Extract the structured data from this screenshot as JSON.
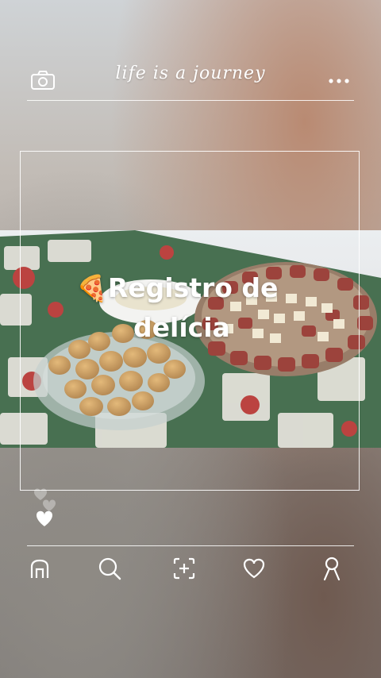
{
  "header": {
    "title": "life is a journey",
    "camera_icon": "camera-icon",
    "more_icon": "more-icon"
  },
  "post": {
    "caption_line1": "Registro de",
    "caption_line2": "delícia",
    "emoji": "🍕"
  },
  "nav": {
    "items": [
      "home-icon",
      "search-icon",
      "add-post-icon",
      "heart-icon",
      "profile-icon"
    ]
  },
  "colors": {
    "line": "#ffffff",
    "tablecloth_green": "#2f5d3a",
    "sausage_red": "#8f2a21",
    "cheese": "#efe6cf",
    "coxinha": "#c9974f"
  }
}
